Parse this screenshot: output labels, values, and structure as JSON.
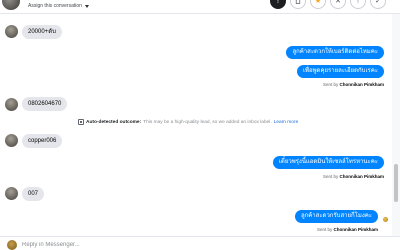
{
  "header": {
    "assign_label": "Assign this conversation",
    "buttons": [
      {
        "name": "info-button",
        "icon": "info-icon",
        "glyph": "!"
      },
      {
        "name": "delete-button",
        "icon": "trash-icon",
        "glyph": "🗑"
      },
      {
        "name": "star-button",
        "icon": "star-icon",
        "glyph": "★"
      },
      {
        "name": "close-button",
        "icon": "close-icon",
        "glyph": "✕"
      },
      {
        "name": "archive-button",
        "icon": "archive-icon",
        "glyph": "↑"
      },
      {
        "name": "done-button",
        "icon": "check-icon",
        "glyph": "✓"
      }
    ]
  },
  "messages": {
    "m1": "20000+ดับ",
    "m2": "ลูกค้าสะดวกให้เบอร์ติดต่อไหมคะ",
    "m3": "เพื่อพูดคุยรายละเอียดกับเรคะ",
    "m2_sent_prefix": "Sent by",
    "m2_sent_name": "Chonnikan Pimkham",
    "m4": "0802604670",
    "sys_strong": "Auto-detected outcome:",
    "sys_text": "This may be a high-quality lead, so we added an inbox label.",
    "sys_link": "Learn more",
    "m5": "copper006",
    "m6": "เดี๋ยวพรุ่งนี้แอดมินให้เซลล์โทรหานะคะ",
    "m6_sent_prefix": "Sent by",
    "m6_sent_name": "Chonnikan Pimkham",
    "m7": "007",
    "m8": "ลูกค้าสะดวกรับสายกี่โมงคะ",
    "m8_sent_prefix": "Sent by",
    "m8_sent_name": "Chonnikan Pimkham"
  },
  "composer": {
    "placeholder": "Reply in Messenger..."
  },
  "colors": {
    "outgoing_bubble": "#0084ff",
    "incoming_bubble": "#e4e6eb",
    "link": "#216fdb"
  }
}
